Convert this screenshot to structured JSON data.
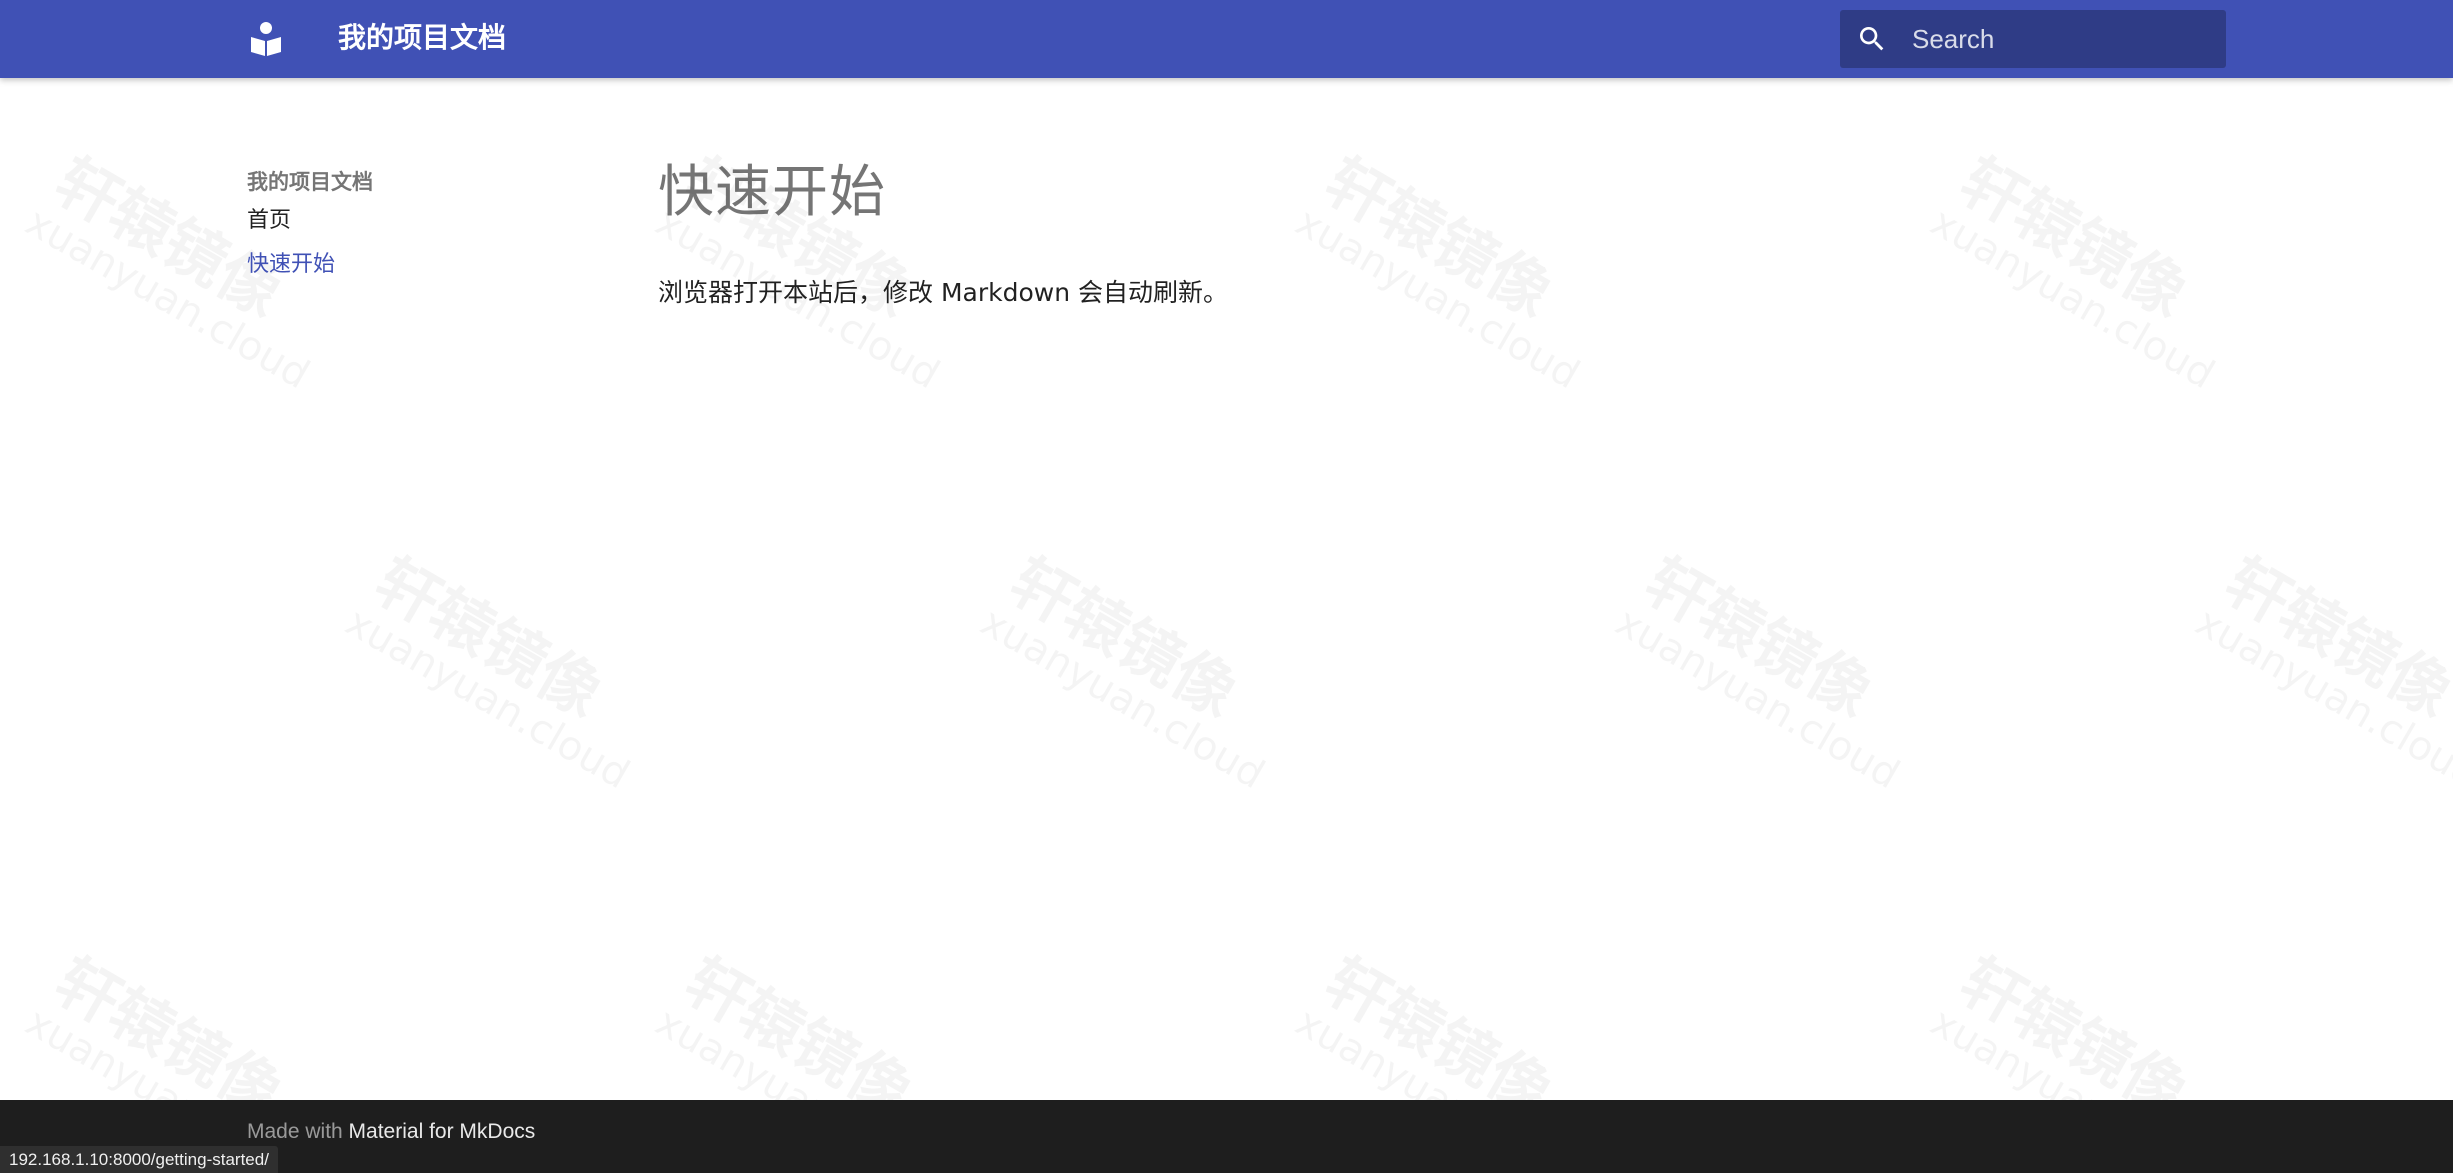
{
  "header": {
    "site_title": "我的项目文档",
    "logo_icon": "book-reader-icon",
    "search": {
      "placeholder": "Search",
      "icon": "search-icon"
    }
  },
  "nav": {
    "title": "我的项目文档",
    "items": [
      {
        "label": "首页",
        "active": false
      },
      {
        "label": "快速开始",
        "active": true
      }
    ]
  },
  "content": {
    "heading": "快速开始",
    "paragraph": "浏览器打开本站后，修改 Markdown 会自动刷新。"
  },
  "footer": {
    "prefix": "Made with ",
    "link_label": "Material for MkDocs"
  },
  "status_bar": {
    "url": "192.168.1.10:8000/getting-started/"
  },
  "watermark": {
    "text_cn": "轩辕镜像",
    "text_en": "xuanyuan.cloud"
  },
  "colors": {
    "primary": "#4051b5",
    "footer_bg": "#1e1e1e",
    "active_link": "#4051b5"
  }
}
